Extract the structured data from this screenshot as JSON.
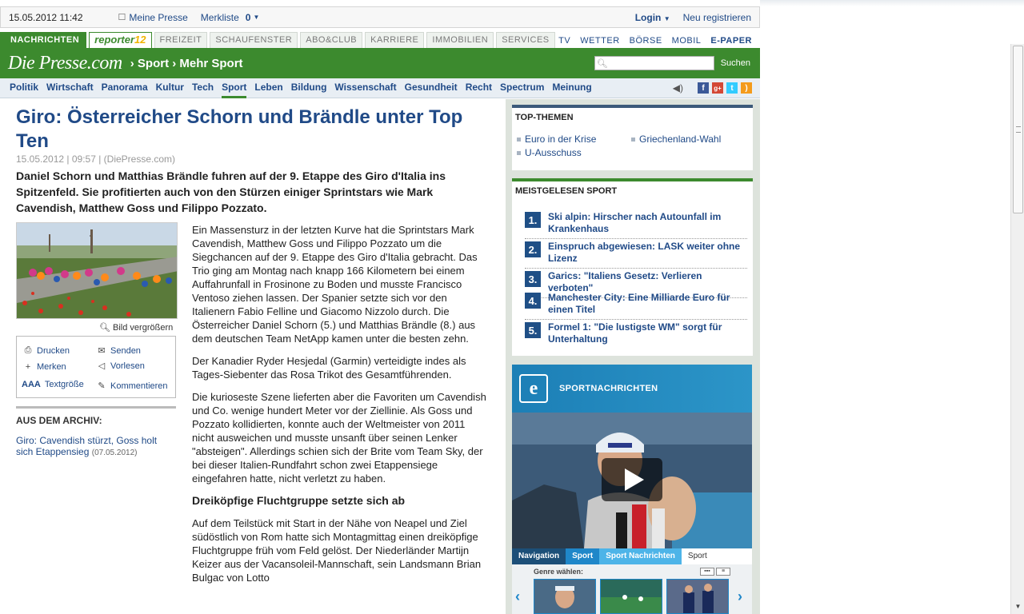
{
  "meta": {
    "datetime": "15.05.2012 11:42",
    "my_press": "Meine Presse",
    "watchlist_label": "Merkliste",
    "watchlist_count": "0",
    "login": "Login",
    "register": "Neu registrieren"
  },
  "sections": {
    "active": "NACHRICHTEN",
    "reporter": "reporter",
    "reporter_num": "12",
    "tabs": [
      "FREIZEIT",
      "SCHAUFENSTER",
      "ABO&CLUB",
      "KARRIERE",
      "IMMOBILIEN",
      "SERVICES"
    ],
    "right": [
      "TV",
      "WETTER",
      "BÖRSE",
      "MOBIL",
      "E-PAPER"
    ]
  },
  "header": {
    "logo": "Die Presse.com",
    "breadcrumb": "› Sport › Mehr Sport",
    "search_button": "Suchen"
  },
  "nav": {
    "items": [
      "Politik",
      "Wirtschaft",
      "Panorama",
      "Kultur",
      "Tech",
      "Sport",
      "Leben",
      "Bildung",
      "Wissenschaft",
      "Gesundheit",
      "Recht",
      "Spectrum",
      "Meinung"
    ],
    "active": "Sport"
  },
  "article": {
    "title": "Giro: Österreicher Schorn und Brändle unter Top Ten",
    "dateline": "15.05.2012 | 09:57 |   (DiePresse.com)",
    "lead": "Daniel Schorn und Matthias Brändle fuhren auf der 9. Etappe des Giro d'Italia ins Spitzenfeld. Sie profitierten auch von den Stürzen einiger Sprintstars wie Mark Cavendish, Matthew Goss und Filippo Pozzato.",
    "enlarge": "Bild vergrößern",
    "tools": {
      "print": "Drucken",
      "send": "Senden",
      "remember": "Merken",
      "read": "Vorlesen",
      "textsize_aa": "AAA",
      "textsize": "Textgröße",
      "comment": "Kommentieren"
    },
    "archive_head": "AUS DEM ARCHIV:",
    "archive_link": "Giro: Cavendish stürzt, Goss holt sich Etappensieg",
    "archive_date": "(07.05.2012)",
    "p1": "Ein Massensturz in der letzten Kurve hat die Sprintstars Mark Cavendish, Matthew Goss und Filippo Pozzato um die Siegchancen auf der 9. Etappe des Giro d'Italia gebracht. Das Trio ging am Montag nach knapp 166 Kilometern bei einem Auffahrunfall in Frosinone zu Boden und musste Francisco Ventoso ziehen lassen. Der Spanier setzte sich vor den Italienern Fabio Felline und Giacomo Nizzolo durch. Die Österreicher Daniel Schorn (5.) und Matthias Brändle (8.) aus dem deutschen Team NetApp kamen unter die besten zehn.",
    "p2": "Der Kanadier Ryder Hesjedal (Garmin) verteidigte indes als Tages-Siebenter das Rosa Trikot des Gesamtführenden.",
    "p3": "Die kurioseste Szene lieferten aber die Favoriten um Cavendish und Co. wenige hundert Meter vor der Ziellinie. Als Goss und Pozzato kollidierten, konnte auch der Weltmeister von 2011 nicht ausweichen und musste unsanft über seinen Lenker \"absteigen\". Allerdings schien sich der Brite vom Team Sky, der bei dieser Italien-Rundfahrt schon zwei Etappensiege eingefahren hatte, nicht verletzt zu haben.",
    "subhead": "Dreiköpfige Fluchtgruppe setzte sich ab",
    "p4": "Auf dem Teilstück mit Start in der Nähe von Neapel und Ziel südöstlich von Rom hatte sich Montagmittag einen dreiköpfige Fluchtgruppe früh vom Feld gelöst. Der Niederländer Martijn Keizer aus der Vacansoleil-Mannschaft, sein Landsmann Brian Bulgac von Lotto"
  },
  "top_themen": {
    "head": "TOP-THEMEN",
    "items": [
      "Euro in der Krise",
      "Griechenland-Wahl",
      "U-Ausschuss"
    ]
  },
  "meistgelesen": {
    "head": "MEISTGELESEN SPORT",
    "items": [
      {
        "num": "1.",
        "text": "Ski alpin: Hirscher nach Autounfall im Krankenhaus"
      },
      {
        "num": "2.",
        "text": "Einspruch abgewiesen: LASK weiter ohne Lizenz"
      },
      {
        "num": "3.",
        "text": "Garics: \"Italiens Gesetz: Verlieren verboten\""
      },
      {
        "num": "4.",
        "text": "Manchester City: Eine Milliarde Euro für einen Titel"
      },
      {
        "num": "5.",
        "text": "Formel 1: \"Die lustigste WM\" sorgt für Unterhaltung"
      }
    ]
  },
  "video": {
    "logo": "e",
    "title": "SPORTNACHRICHTEN",
    "nav": [
      "Navigation",
      "Sport",
      "Sport Nachrichten",
      "Sport Nachrichten"
    ],
    "genre_label": "Genre wählen:"
  },
  "colors": {
    "brand_green": "#3c8a2e",
    "link_blue": "#204a87",
    "video_blue": "#1f87b9"
  }
}
